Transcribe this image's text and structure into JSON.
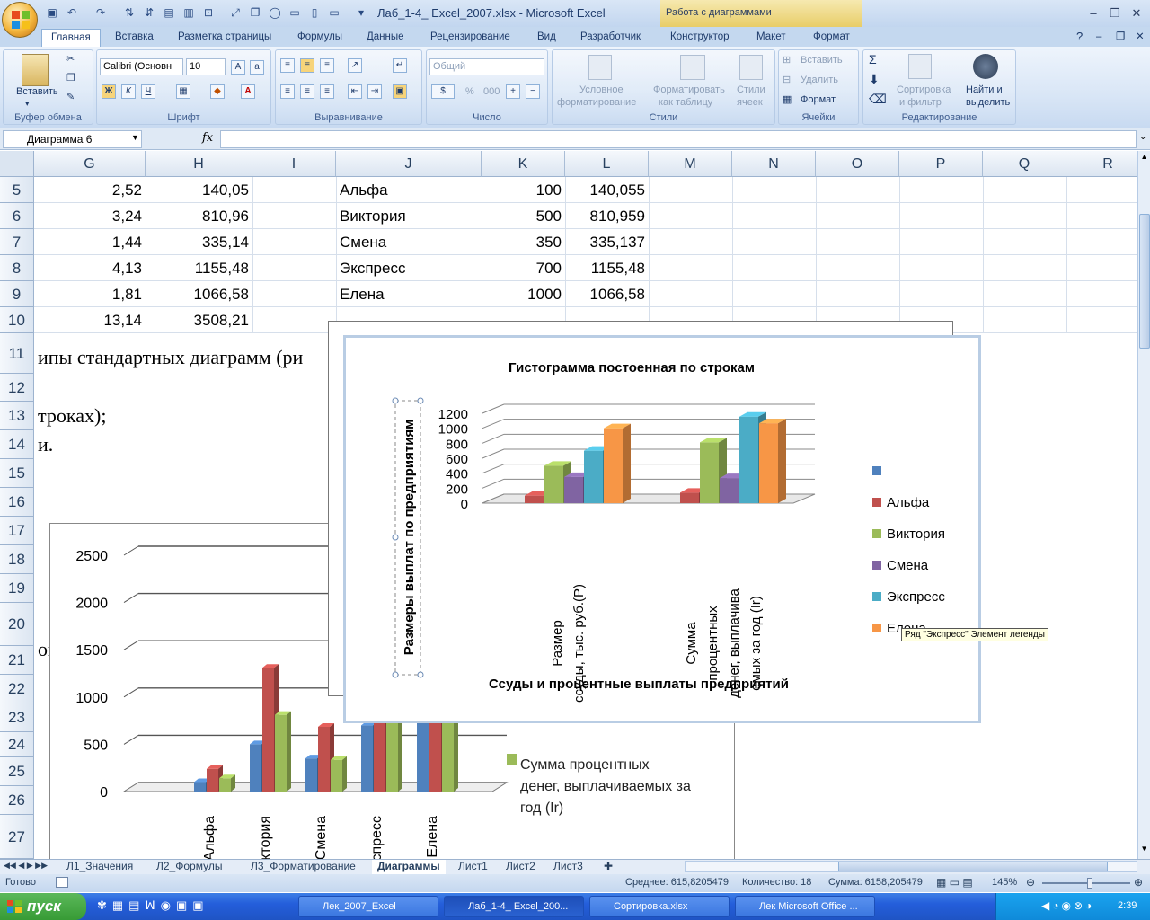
{
  "window": {
    "title": "Лаб_1-4_ Excel_2007.xlsx - Microsoft Excel",
    "context_header": "Работа с диаграммами"
  },
  "tabs": [
    "Главная",
    "Вставка",
    "Разметка страницы",
    "Формулы",
    "Данные",
    "Рецензирование",
    "Вид",
    "Разработчик",
    "Конструктор",
    "Макет",
    "Формат"
  ],
  "ribbon": {
    "clipboard": {
      "label": "Буфер обмена",
      "paste": "Вставить"
    },
    "font": {
      "label": "Шрифт",
      "name": "Calibri (Основн",
      "size": "10",
      "bold": "Ж",
      "italic": "К",
      "underline": "Ч"
    },
    "alignment": {
      "label": "Выравнивание"
    },
    "number": {
      "label": "Число",
      "format": "Общий",
      "percent": "%",
      "thousands": "000"
    },
    "styles": {
      "label": "Стили",
      "cond1": "Условное",
      "cond2": "форматирование",
      "table1": "Форматировать",
      "table2": "как таблицу",
      "cell1": "Стили",
      "cell2": "ячеек"
    },
    "cells": {
      "label": "Ячейки",
      "insert": "Вставить",
      "delete": "Удалить",
      "format": "Формат"
    },
    "editing": {
      "label": "Редактирование",
      "sort1": "Сортировка",
      "sort2": "и фильтр",
      "find1": "Найти и",
      "find2": "выделить"
    }
  },
  "formula_bar": {
    "name_box": "Диаграмма 6",
    "fx": "fx",
    "value": ""
  },
  "columns": [
    "G",
    "H",
    "I",
    "J",
    "K",
    "L",
    "M",
    "N",
    "O",
    "P",
    "Q",
    "R"
  ],
  "rows": [
    {
      "num": "5",
      "g": "2,52",
      "h": "140,05",
      "j": "Альфа",
      "k": "100",
      "l": "140,055"
    },
    {
      "num": "6",
      "g": "3,24",
      "h": "810,96",
      "j": "Виктория",
      "k": "500",
      "l": "810,959"
    },
    {
      "num": "7",
      "g": "1,44",
      "h": "335,14",
      "j": "Смена",
      "k": "350",
      "l": "335,137"
    },
    {
      "num": "8",
      "g": "4,13",
      "h": "1155,48",
      "j": "Экспресс",
      "k": "700",
      "l": "1155,48"
    },
    {
      "num": "9",
      "g": "1,81",
      "h": "1066,58",
      "j": "Елена",
      "k": "1000",
      "l": "1066,58"
    },
    {
      "num": "10",
      "g": "13,14",
      "h": "3508,21",
      "j": "",
      "k": "",
      "l": ""
    }
  ],
  "more_rows": [
    "11",
    "12",
    "13",
    "14",
    "15",
    "16",
    "17",
    "18",
    "19",
    "20",
    "21",
    "22",
    "23",
    "24",
    "25",
    "26",
    "27"
  ],
  "text_cells": {
    "r11": "ипы стандартных диаграмм (ри",
    "r13": "троках);",
    "r14": "и.",
    "r20": "ок"
  },
  "chart_data": [
    {
      "type": "bar",
      "title": "Гистограмма постоенная по строкам",
      "xlabel": "Ссуды и процентные выплаты предприятий",
      "ylabel": "Размеры выплат по предприятиям",
      "categories": [
        "Размер ссуды, тыс. руб.(P)",
        "Сумма процентных денег, выплачива емых за год (Ir)"
      ],
      "category_lines": [
        [
          "Размер",
          "ссуды, тыс. руб.(P)"
        ],
        [
          "Сумма",
          "процентных",
          "денег, выплачива",
          "емых за год (Ir)"
        ]
      ],
      "yticks": [
        "0",
        "200",
        "400",
        "600",
        "800",
        "1000",
        "1200"
      ],
      "ylim": [
        0,
        1200
      ],
      "legend_position": "right",
      "series": [
        {
          "name": "",
          "color": "#4f81bd",
          "values": [
            0,
            0
          ]
        },
        {
          "name": "Альфа",
          "color": "#c0504d",
          "values": [
            100,
            140.055
          ]
        },
        {
          "name": "Виктория",
          "color": "#9bbb59",
          "values": [
            500,
            810.959
          ]
        },
        {
          "name": "Смена",
          "color": "#8064a2",
          "values": [
            350,
            335.137
          ]
        },
        {
          "name": "Экспресс",
          "color": "#4bacc6",
          "values": [
            700,
            1155.48
          ]
        },
        {
          "name": "Елена",
          "color": "#f79646",
          "values": [
            1000,
            1066.58
          ]
        }
      ],
      "tooltip": "Ряд \"Экспресс\" Элемент легенды"
    },
    {
      "type": "bar",
      "categories": [
        "Альфа",
        "Виктория",
        "Смена",
        "Экспресс",
        "Елена"
      ],
      "category_labels_visible": [
        "Альфа",
        "ктория",
        "Смена",
        "кспресс",
        "Елена"
      ],
      "yticks": [
        "0",
        "500",
        "1000",
        "1500",
        "2000",
        "2500"
      ],
      "ylim": [
        0,
        2500
      ],
      "series": [
        {
          "name": "",
          "color": "#4f81bd",
          "values": [
            100,
            500,
            350,
            700,
            1000
          ]
        },
        {
          "name": "",
          "color": "#c0504d",
          "values": [
            240,
            1310,
            685,
            1850,
            2070
          ]
        },
        {
          "name": "Сумма процентных денег, выплачиваемых за год (Ir)",
          "color": "#9bbb59",
          "values": [
            140,
            811,
            335,
            1155,
            1067
          ]
        }
      ],
      "legend_lines": [
        "Сумма процентных",
        "денег, выплачиваемых за",
        "год (Ir)"
      ]
    }
  ],
  "sheets": [
    "Л1_Значения",
    "Л2_Формулы",
    "Л3_Форматирование",
    "Диаграммы",
    "Лист1",
    "Лист2",
    "Лист3"
  ],
  "status": {
    "ready": "Готово",
    "average": "Среднее: 615,8205479",
    "count": "Количество: 18",
    "sum": "Сумма: 6158,205479",
    "zoom": "145%"
  },
  "taskbar": {
    "start": "пуск",
    "tasks": [
      "Лек_2007_Excel",
      "Лаб_1-4_ Excel_200...",
      "Сортировка.xlsx",
      "Лек Microsoft Office ..."
    ],
    "lang": "RU",
    "clock": "2:39"
  }
}
